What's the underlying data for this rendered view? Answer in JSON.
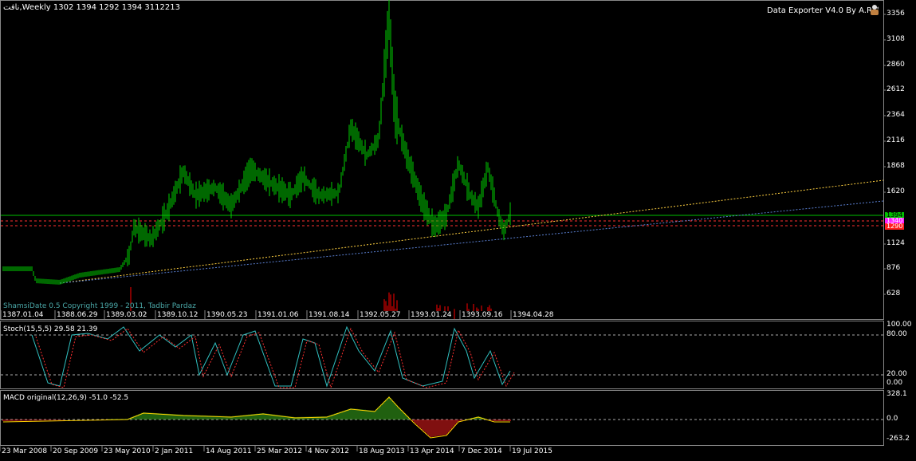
{
  "header": {
    "symbol_info": "ﻧﺎﻓﺖ,Weekly  1302 1394 1292 1394  3112213",
    "exporter": "Data Exporter V4.0 By A.R™",
    "copyright": "ShamsiDate 0.5 Copyright 1999 - 2011, Tadbir Pardaz"
  },
  "icons": {
    "exporter_icon": "person-bag-icon"
  },
  "colors": {
    "price": "#00d000",
    "hline_green": "#00c000",
    "hline_red": "#ff3030",
    "trend_yellow": "#ffd040",
    "trend_blue": "#5a7fd0",
    "stoch_main": "#30c0c0",
    "stoch_signal": "#ff3030",
    "macd_pos": "#40c020",
    "macd_neg": "#ff2020",
    "macd_signal": "#ffd000",
    "volume": "#ff0000"
  },
  "price_axis": {
    "labels": [
      "3356",
      "3108",
      "2860",
      "2612",
      "2364",
      "2116",
      "1868",
      "1620",
      "1124",
      "876",
      "628"
    ]
  },
  "price_badges": [
    "1394",
    "1340",
    "1290"
  ],
  "shamsi_dates": [
    "1387.01.04",
    "1388.06.29",
    "1389.03.02",
    "1389.10.12",
    "1390.05.23",
    "1391.01.06",
    "1391.08.14",
    "1392.05.27",
    "1393.01.24",
    "1393.09.16",
    "1394.04.28"
  ],
  "stoch": {
    "title": "Stoch(15,5,5) 29.58 21.39",
    "axis": [
      "100.00",
      "80.00",
      "20.00",
      "0.00"
    ]
  },
  "macd": {
    "title": "MACD original(12,26,9) -51.0 -52.5",
    "axis": [
      "328.1",
      "0.0",
      "-263.2"
    ]
  },
  "time_axis": {
    "labels": [
      "23 Mar 2008",
      "20 Sep 2009",
      "23 May 2010",
      "2 Jan 2011",
      "14 Aug 2011",
      "25 Mar 2012",
      "4 Nov 2012",
      "18 Aug 2013",
      "13 Apr 2014",
      "7 Dec 2014",
      "19 Jul 2015"
    ]
  }
}
